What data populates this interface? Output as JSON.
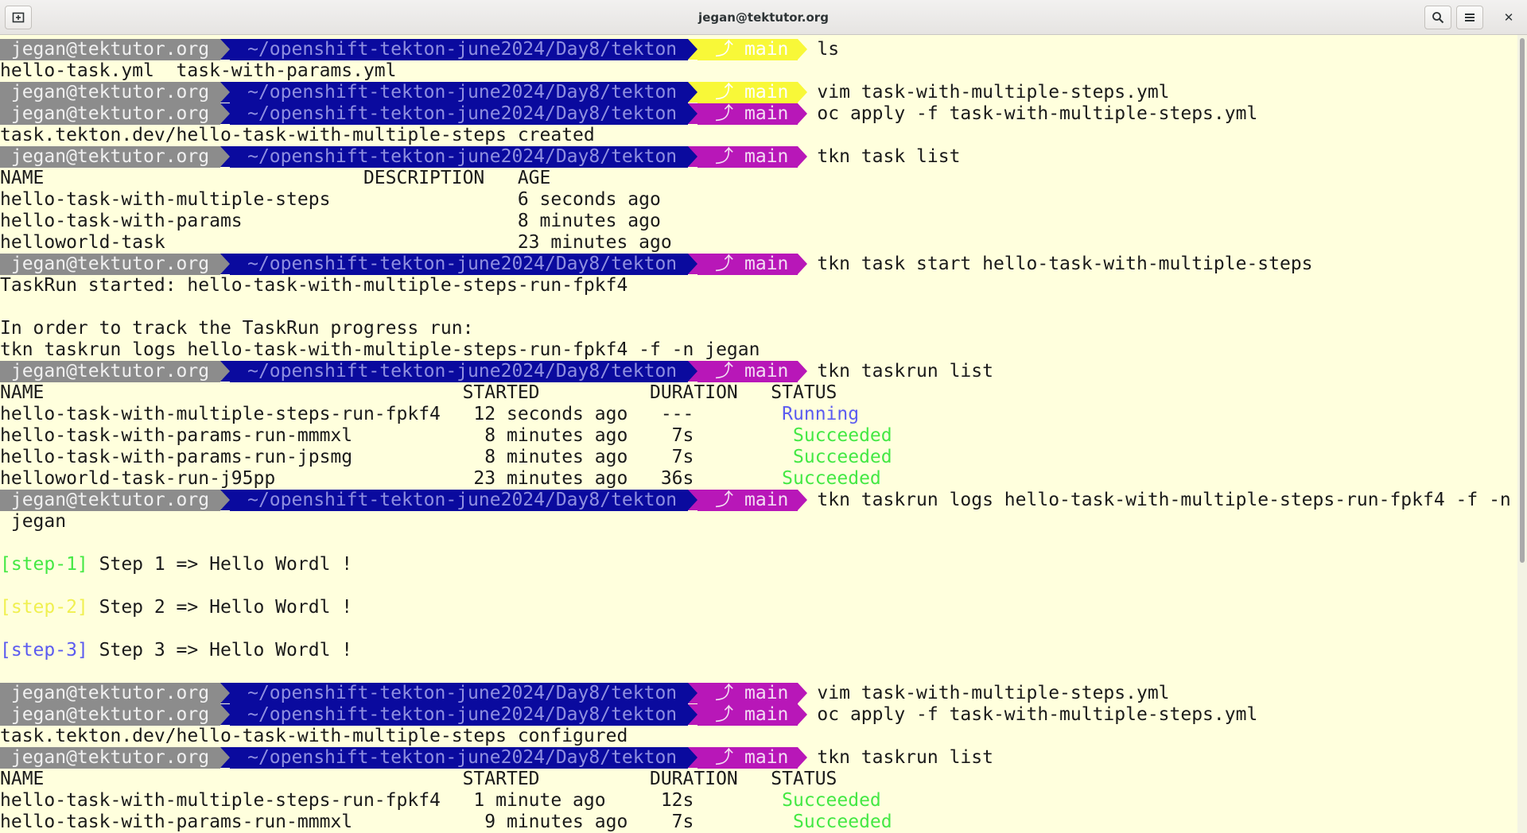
{
  "window": {
    "title": "jegan@tektutor.org",
    "icons": {
      "new_tab": "new-tab-icon",
      "search": "search-icon",
      "menu": "hamburger-menu-icon",
      "close": "close-icon"
    },
    "close_glyph": "✕"
  },
  "prompt": {
    "user": " jegan@tektutor.org",
    "path": "~/openshift-tekton-june2024/Day8/tekton",
    "branch_glyph": "⤴",
    "branch": " main"
  },
  "colors": {
    "background": "#ffffdd",
    "prompt_user": "#8c8c8c",
    "prompt_path": "#0a0a9e",
    "git_clean": "#f8f838",
    "git_dirty": "#b817b8",
    "status_running": "#5b5bf0",
    "status_succeeded": "#44e844"
  },
  "lines": [
    {
      "type": "prompt",
      "git": "yellow",
      "cmd": "ls"
    },
    {
      "type": "out",
      "text": "hello-task.yml  task-with-params.yml"
    },
    {
      "type": "prompt",
      "git": "yellow",
      "cmd": "vim task-with-multiple-steps.yml"
    },
    {
      "type": "prompt",
      "git": "magenta",
      "cmd": "oc apply -f task-with-multiple-steps.yml"
    },
    {
      "type": "out",
      "text": "task.tekton.dev/hello-task-with-multiple-steps created"
    },
    {
      "type": "prompt",
      "git": "magenta",
      "cmd": "tkn task list"
    },
    {
      "type": "out",
      "text": "NAME                             DESCRIPTION   AGE"
    },
    {
      "type": "out",
      "text": "hello-task-with-multiple-steps                 6 seconds ago"
    },
    {
      "type": "out",
      "text": "hello-task-with-params                         8 minutes ago"
    },
    {
      "type": "out",
      "text": "helloworld-task                                23 minutes ago"
    },
    {
      "type": "prompt",
      "git": "magenta",
      "cmd": "tkn task start hello-task-with-multiple-steps"
    },
    {
      "type": "out",
      "text": "TaskRun started: hello-task-with-multiple-steps-run-fpkf4"
    },
    {
      "type": "out",
      "text": ""
    },
    {
      "type": "out",
      "text": "In order to track the TaskRun progress run:"
    },
    {
      "type": "out",
      "text": "tkn taskrun logs hello-task-with-multiple-steps-run-fpkf4 -f -n jegan"
    },
    {
      "type": "prompt",
      "git": "magenta",
      "cmd": "tkn taskrun list"
    },
    {
      "type": "out",
      "text": "NAME                                      STARTED          DURATION   STATUS"
    },
    {
      "type": "row",
      "text": "hello-task-with-multiple-steps-run-fpkf4   12 seconds ago   ---        ",
      "status": "Running",
      "kind": "running"
    },
    {
      "type": "row",
      "text": "hello-task-with-params-run-mmmxl            8 minutes ago    7s         ",
      "status": "Succeeded",
      "kind": "succeeded"
    },
    {
      "type": "row",
      "text": "hello-task-with-params-run-jpsmg            8 minutes ago    7s         ",
      "status": "Succeeded",
      "kind": "succeeded"
    },
    {
      "type": "row",
      "text": "helloworld-task-run-j95pp                  23 minutes ago   36s        ",
      "status": "Succeeded",
      "kind": "succeeded"
    },
    {
      "type": "prompt",
      "git": "magenta",
      "cmd": "tkn taskrun logs hello-task-with-multiple-steps-run-fpkf4 -f -n"
    },
    {
      "type": "out",
      "text": " jegan"
    },
    {
      "type": "out",
      "text": ""
    },
    {
      "type": "step",
      "tag": "[step-1]",
      "kind": "1",
      "text": " Step 1 => Hello Wordl !"
    },
    {
      "type": "out",
      "text": ""
    },
    {
      "type": "step",
      "tag": "[step-2]",
      "kind": "2",
      "text": " Step 2 => Hello Wordl !"
    },
    {
      "type": "out",
      "text": ""
    },
    {
      "type": "step",
      "tag": "[step-3]",
      "kind": "3",
      "text": " Step 3 => Hello Wordl !"
    },
    {
      "type": "out",
      "text": ""
    },
    {
      "type": "prompt",
      "git": "magenta",
      "cmd": "vim task-with-multiple-steps.yml"
    },
    {
      "type": "prompt",
      "git": "magenta",
      "cmd": "oc apply -f task-with-multiple-steps.yml"
    },
    {
      "type": "out",
      "text": "task.tekton.dev/hello-task-with-multiple-steps configured"
    },
    {
      "type": "prompt",
      "git": "magenta",
      "cmd": "tkn taskrun list"
    },
    {
      "type": "out",
      "text": "NAME                                      STARTED          DURATION   STATUS"
    },
    {
      "type": "row",
      "text": "hello-task-with-multiple-steps-run-fpkf4   1 minute ago     12s        ",
      "status": "Succeeded",
      "kind": "succeeded"
    },
    {
      "type": "row",
      "text": "hello-task-with-params-run-mmmxl            9 minutes ago    7s         ",
      "status": "Succeeded",
      "kind": "succeeded"
    }
  ]
}
